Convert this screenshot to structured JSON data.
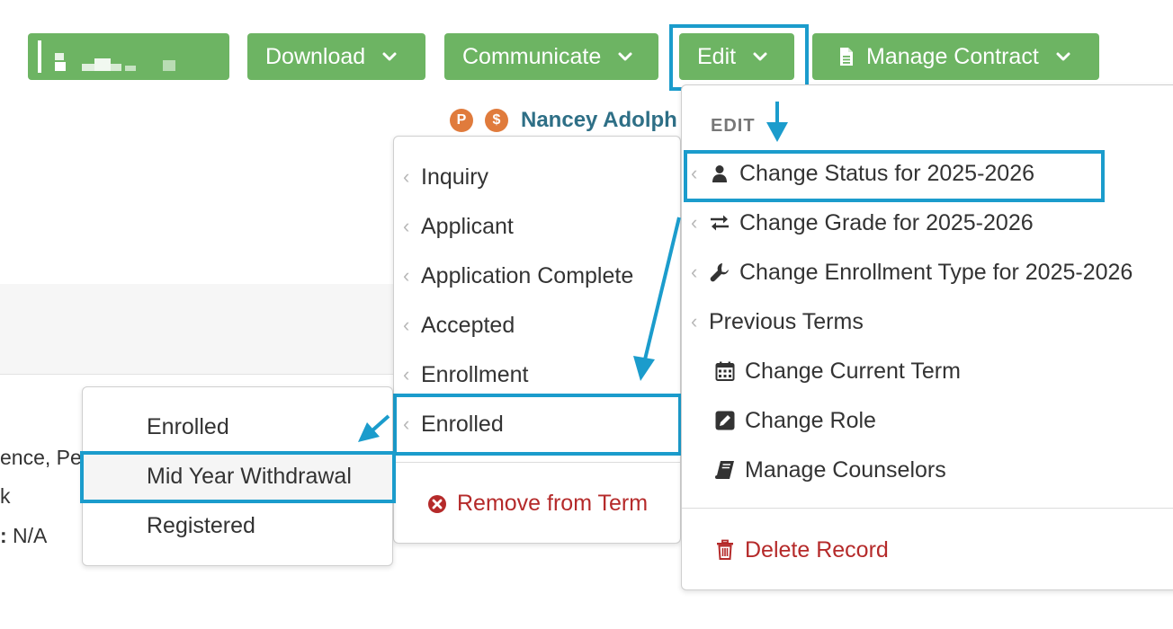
{
  "toolbar": {
    "download_label": "Download",
    "communicate_label": "Communicate",
    "edit_label": "Edit",
    "manage_contract_label": "Manage Contract"
  },
  "record": {
    "badge_p": "P",
    "badge_s": "$",
    "name": "Nancey Adolph"
  },
  "background": {
    "line1": "ence, Pe",
    "line2": "k",
    "line3_key": ":",
    "line3_value": " N/A"
  },
  "edit_menu": {
    "heading": "EDIT",
    "items": [
      {
        "label": "Change Status for 2025-2026",
        "icon": "user-icon"
      },
      {
        "label": "Change Grade for 2025-2026",
        "icon": "swap-arrows-icon"
      },
      {
        "label": "Change Enrollment Type for 2025-2026",
        "icon": "wrench-icon"
      },
      {
        "label": "Previous Terms"
      },
      {
        "label": "Change Current Term",
        "icon": "calendar-icon"
      },
      {
        "label": "Change Role",
        "icon": "pencil-square-icon"
      },
      {
        "label": "Manage Counselors",
        "icon": "book-icon"
      }
    ],
    "delete_label": "Delete Record"
  },
  "status_menu": {
    "items": [
      "Inquiry",
      "Applicant",
      "Application Complete",
      "Accepted",
      "Enrollment",
      "Enrolled"
    ],
    "remove_label": "Remove from Term"
  },
  "enrolled_menu": {
    "items": [
      "Enrolled",
      "Mid Year Withdrawal",
      "Registered"
    ]
  },
  "colors": {
    "button_green": "#6db463",
    "highlight_blue": "#1b9ccc",
    "danger_red": "#b52a2a",
    "name_teal": "#2e6f86",
    "badge_orange": "#e07b3c"
  }
}
